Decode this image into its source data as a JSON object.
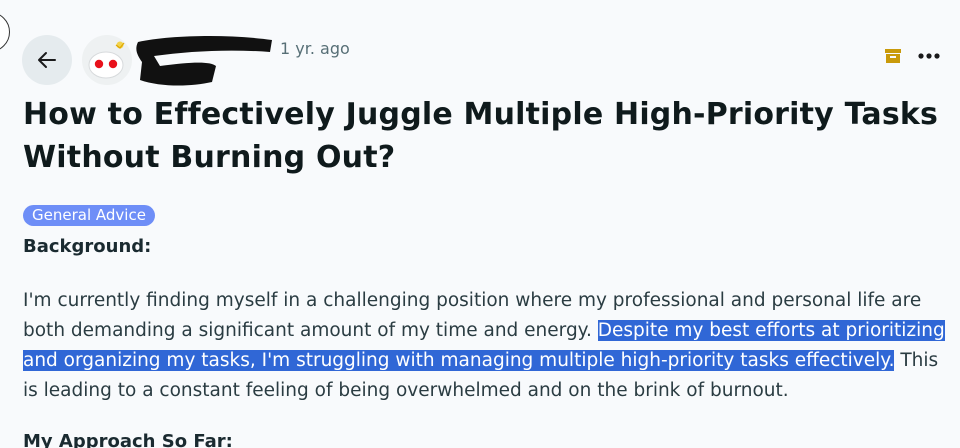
{
  "header": {
    "time_ago": "1 yr. ago"
  },
  "post": {
    "title": "How to Effectively Juggle Multiple High-Priority Tasks Without Burning Out?",
    "flair": "General Advice",
    "sections": [
      {
        "heading": "Background:",
        "paragraph": {
          "before": "I'm currently finding myself in a challenging position where my professional and personal life are both demanding a significant amount of my time and energy. ",
          "highlighted": "Despite my best efforts at prioritizing and organizing my tasks, I'm struggling with managing multiple high-priority tasks effectively.",
          "after": " This is leading to a constant feeling of being overwhelmed and on the brink of burnout."
        }
      },
      {
        "heading": "My Approach So Far:"
      }
    ]
  },
  "colors": {
    "selection": "#3067d6",
    "flair": "#6e8ef7",
    "archive_icon": "#c99a0a"
  },
  "icons": {
    "back": "arrow-left-icon",
    "archive": "archive-icon",
    "more": "more-options-icon"
  }
}
